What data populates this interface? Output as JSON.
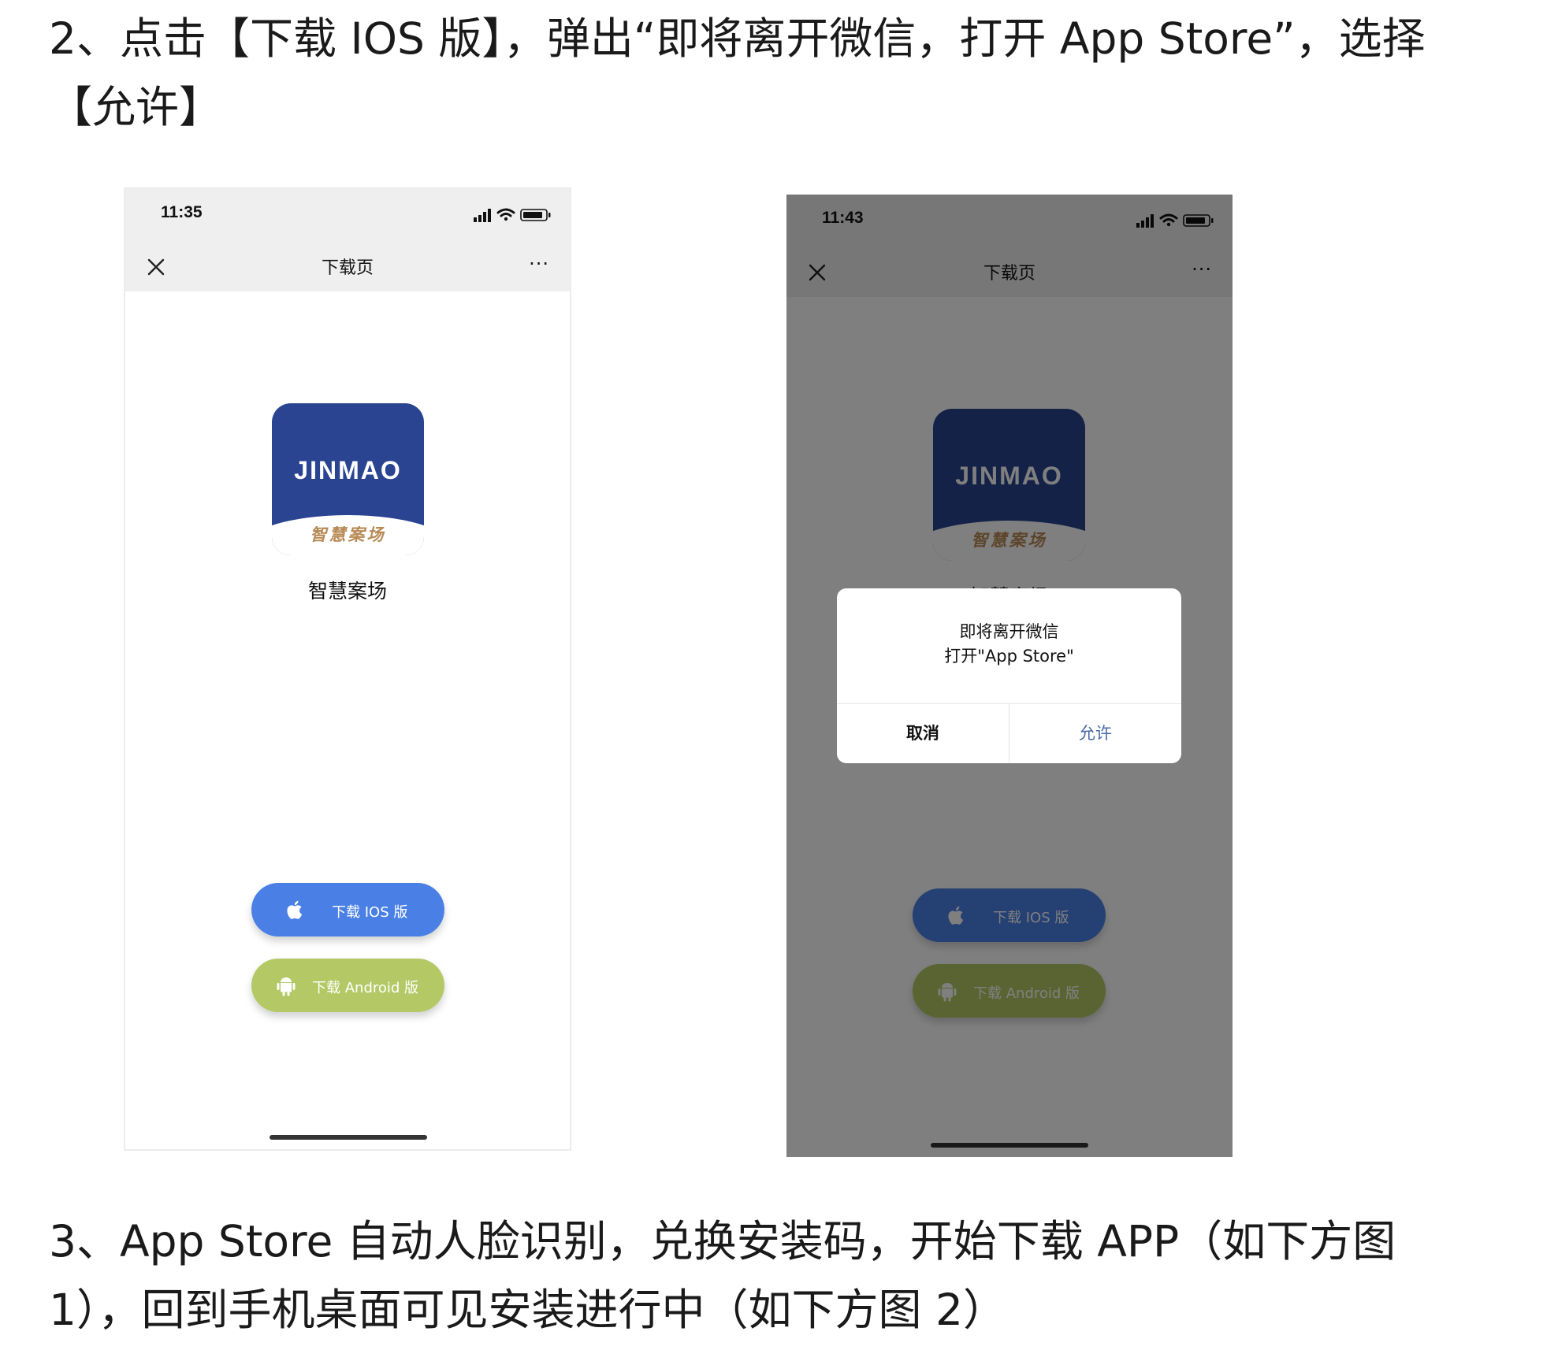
{
  "step2": {
    "text": "2、点击【下载 IOS 版】，弹出“即将离开微信，打开 App Store”，选择【允许】"
  },
  "step3": {
    "text": "3、App Store 自动人脸识别，兑换安装码，开始下载 APP（如下方图 1），回到手机桌面可见安装进行中（如下方图 2）"
  },
  "phone1": {
    "time": "11:35",
    "nav_title": "下载页",
    "more": "···",
    "app_brand": "JINMAO",
    "app_brand_sub": "智慧案场",
    "app_name": "智慧案场",
    "btn_ios": "下载 IOS 版",
    "btn_android": "下载 Android 版"
  },
  "phone2": {
    "time": "11:43",
    "nav_title": "下载页",
    "more": "···",
    "app_brand": "JINMAO",
    "app_brand_sub": "智慧案场",
    "app_name": "智慧案场",
    "btn_ios": "下载 IOS 版",
    "btn_android": "下载 Android 版",
    "dialog": {
      "line1": "即将离开微信",
      "line2": "打开\"App Store\"",
      "cancel": "取消",
      "allow": "允许"
    }
  },
  "colors": {
    "ios_button": "#4a80e6",
    "android_button": "#b4c965",
    "app_icon": "#2a4491",
    "brand_sub": "#b78a55",
    "dialog_allow": "#4a6aa5"
  },
  "icons": [
    "close-icon",
    "more-icon",
    "signal-icon",
    "wifi-icon",
    "battery-icon",
    "apple-icon",
    "android-icon"
  ]
}
